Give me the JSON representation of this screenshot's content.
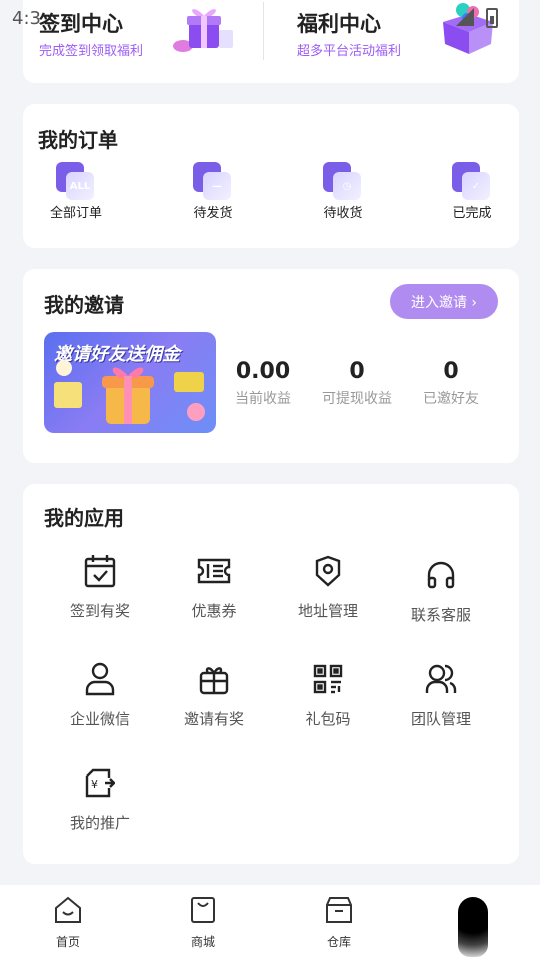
{
  "status_bar": {
    "time": "4:3"
  },
  "welfare": {
    "sign_in": {
      "title": "签到中心",
      "subtitle": "完成签到领取福利"
    },
    "benefits": {
      "title": "福利中心",
      "subtitle": "超多平台活动福利"
    }
  },
  "orders": {
    "title": "我的订单",
    "items": [
      {
        "label": "全部订单",
        "glyph": "ALL",
        "icon": "all-orders-icon"
      },
      {
        "label": "待发货",
        "glyph": "—",
        "icon": "pending-ship-icon"
      },
      {
        "label": "待收货",
        "glyph": "◷",
        "icon": "pending-receive-icon"
      },
      {
        "label": "已完成",
        "glyph": "✓",
        "icon": "completed-icon"
      }
    ]
  },
  "invite": {
    "title": "我的邀请",
    "button_label": "进入邀请 ›",
    "banner_text": "邀请好友送佣金",
    "stats": [
      {
        "value": "0.00",
        "label": "当前收益"
      },
      {
        "value": "0",
        "label": "可提现收益"
      },
      {
        "value": "0",
        "label": "已邀好友"
      }
    ]
  },
  "apps": {
    "title": "我的应用",
    "items": [
      {
        "label": "签到有奖",
        "icon": "calendar-check-icon"
      },
      {
        "label": "优惠券",
        "icon": "coupon-icon"
      },
      {
        "label": "地址管理",
        "icon": "location-icon"
      },
      {
        "label": "联系客服",
        "icon": "headset-icon"
      },
      {
        "label": "企业微信",
        "icon": "user-icon"
      },
      {
        "label": "邀请有奖",
        "icon": "gift-icon"
      },
      {
        "label": "礼包码",
        "icon": "qr-code-icon"
      },
      {
        "label": "团队管理",
        "icon": "team-icon"
      },
      {
        "label": "我的推广",
        "icon": "promotion-icon"
      }
    ]
  },
  "bottom_nav": {
    "items": [
      {
        "label": "首页",
        "icon": "home-icon"
      },
      {
        "label": "商城",
        "icon": "shop-bag-icon"
      },
      {
        "label": "仓库",
        "icon": "warehouse-icon"
      }
    ]
  },
  "colors": {
    "accent": "#9b5cf6",
    "button": "#b18cf0",
    "order_icon": "#7b5ee8"
  }
}
